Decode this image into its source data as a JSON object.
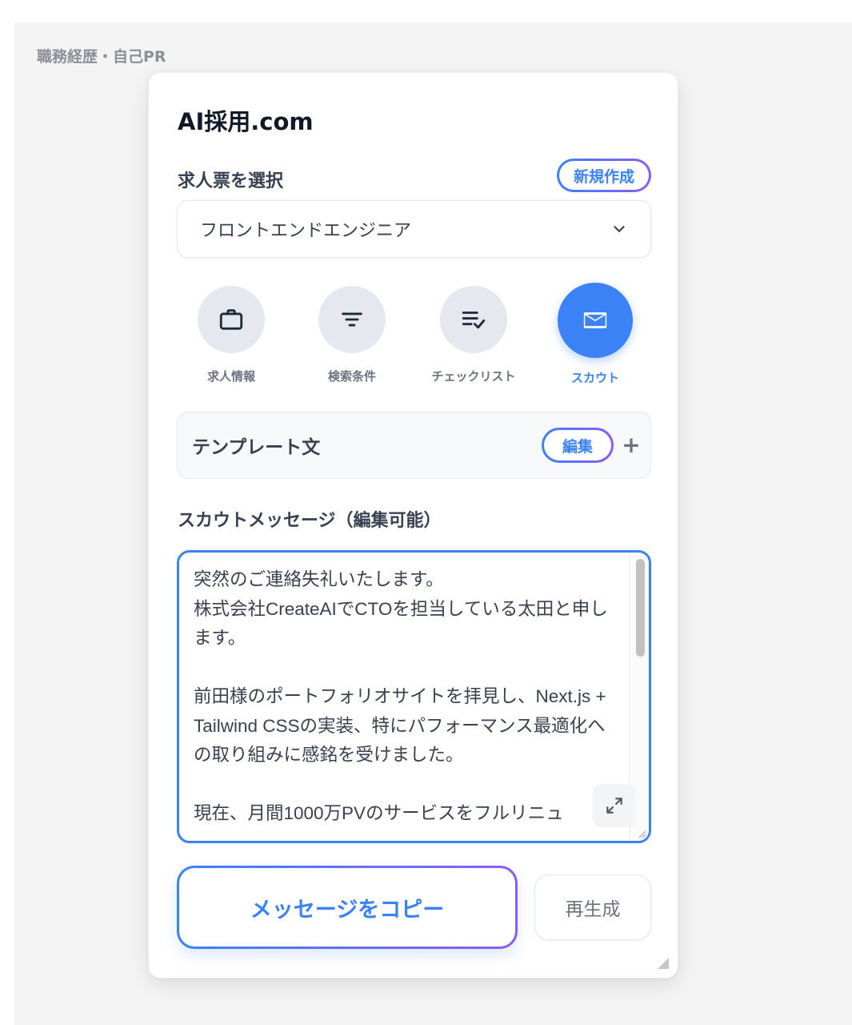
{
  "background": {
    "section_label": "職務経歴・自己PR"
  },
  "panel": {
    "app_title": "AI採用.com",
    "job_select": {
      "label": "求人票を選択",
      "new_button": "新規作成",
      "selected_value": "フロントエンドエンジニア"
    },
    "tabs": [
      {
        "label": "求人情報",
        "icon": "briefcase-icon",
        "active": false
      },
      {
        "label": "検索条件",
        "icon": "filter-icon",
        "active": false
      },
      {
        "label": "チェックリスト",
        "icon": "checklist-icon",
        "active": false
      },
      {
        "label": "スカウト",
        "icon": "mail-icon",
        "active": true
      }
    ],
    "template": {
      "title": "テンプレート文",
      "edit_button": "編集",
      "add_button": "+"
    },
    "message": {
      "label": "スカウトメッセージ（編集可能）",
      "text": "突然のご連絡失礼いたします。\n株式会社CreateAIでCTOを担当している太田と申します。\n\n前田様のポートフォリオサイトを拝見し、Next.js + Tailwind CSSの実装、特にパフォーマンス最適化への取り組みに感銘を受けました。\n\n現在、月間1000万PVのサービスをフルリニュ"
    },
    "actions": {
      "copy_button": "メッセージをコピー",
      "regenerate_button": "再生成"
    }
  },
  "colors": {
    "accent": "#3b82f6",
    "accent_gradient_end": "#8b5cf6",
    "text_primary": "#374151",
    "text_muted": "#6b7280"
  }
}
